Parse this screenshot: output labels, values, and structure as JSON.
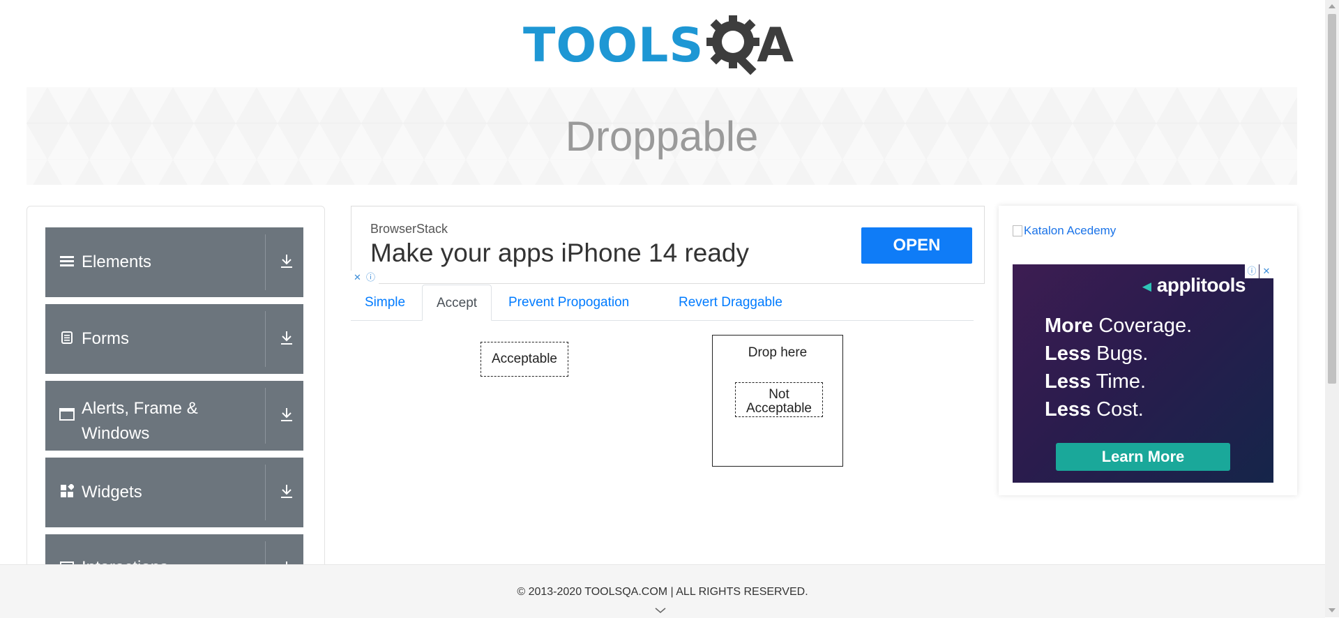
{
  "header": {
    "logo_text_left": "TOOLS",
    "logo_text_right": "A"
  },
  "banner": {
    "title": "Droppable"
  },
  "sidebar": {
    "groups": [
      {
        "label": "Elements",
        "icon": "hamburger-icon"
      },
      {
        "label": "Forms",
        "icon": "document-icon"
      },
      {
        "label": "Alerts, Frame & Windows",
        "icon": "window-icon"
      },
      {
        "label": "Widgets",
        "icon": "grid-icon"
      },
      {
        "label": "Interactions",
        "icon": "list-icon"
      }
    ]
  },
  "ad": {
    "brand": "BrowserStack",
    "headline": "Make your apps iPhone 14 ready",
    "button": "OPEN"
  },
  "tabs": {
    "items": [
      {
        "label": "Simple",
        "active": false
      },
      {
        "label": "Accept",
        "active": true
      },
      {
        "label": "Prevent Propogation",
        "active": false
      },
      {
        "label": "Revert Draggable",
        "active": false
      }
    ]
  },
  "droppable": {
    "acceptable": "Acceptable",
    "drop_label": "Drop here",
    "not_acceptable": "Not Acceptable"
  },
  "right_ad": {
    "katalon_alt": "Katalon Acedemy",
    "brand": "applitools",
    "lines": [
      {
        "bold": "More",
        "rest": " Coverage."
      },
      {
        "bold": "Less",
        "rest": " Bugs."
      },
      {
        "bold": "Less",
        "rest": " Time."
      },
      {
        "bold": "Less",
        "rest": " Cost."
      }
    ],
    "cta": "Learn More"
  },
  "footer": {
    "text": "© 2013-2020 TOOLSQA.COM | ALL RIGHTS RESERVED."
  },
  "colors": {
    "sidebar_bg": "#6c757d",
    "link": "#007bff",
    "logo_blue": "#1e97d4",
    "logo_dark": "#3d3d3d",
    "ad_button": "#0f7cf7",
    "cta": "#1aa89a"
  }
}
